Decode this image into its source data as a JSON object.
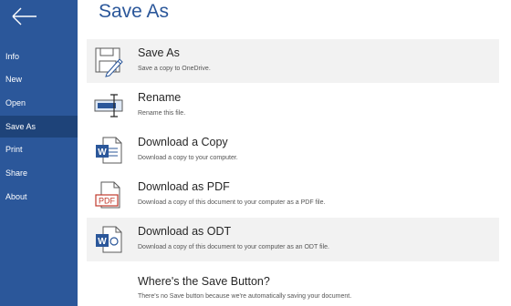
{
  "page_title": "Save As",
  "sidebar": {
    "back_icon": "left-arrow-icon",
    "items": [
      {
        "label": "Info"
      },
      {
        "label": "New"
      },
      {
        "label": "Open"
      },
      {
        "label": "Save As",
        "active": true
      },
      {
        "label": "Print"
      },
      {
        "label": "Share"
      },
      {
        "label": "About"
      }
    ]
  },
  "actions": [
    {
      "title": "Save As",
      "desc": "Save a copy to OneDrive.",
      "icon": "save-as-icon"
    },
    {
      "title": "Rename",
      "desc": "Rename this file.",
      "icon": "rename-icon"
    },
    {
      "title": "Download a Copy",
      "desc": "Download a copy to your computer.",
      "icon": "word-document-icon",
      "badge": "W"
    },
    {
      "title": "Download as PDF",
      "desc": "Download a copy of this document to your computer as a PDF file.",
      "icon": "pdf-icon",
      "badge": "PDF"
    },
    {
      "title": "Download as ODT",
      "desc": "Download a copy of this document to your computer as an ODT file.",
      "icon": "odt-document-icon",
      "badge": "W"
    }
  ],
  "info": {
    "title": "Where's the Save Button?",
    "desc": "There's no Save button because we're automatically saving your document."
  },
  "colors": {
    "accent": "#2b579a",
    "sidebar_active": "#1e4379",
    "row_highlight": "#f2f2f2",
    "pdf_red": "#c0392b"
  }
}
